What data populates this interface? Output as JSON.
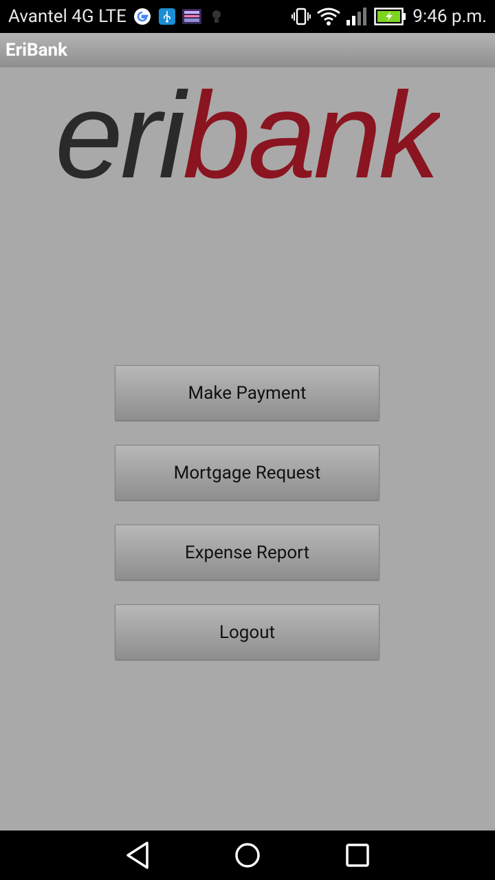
{
  "status_bar": {
    "carrier": "Avantel 4G LTE",
    "time": "9:46 p.m.",
    "icons": [
      "google-icon",
      "usb-icon",
      "app-notification-icon",
      "bulb-icon",
      "vibrate-icon",
      "wifi-icon",
      "signal-icon",
      "battery-charging-icon"
    ],
    "battery_color": "#7ed321"
  },
  "action_bar": {
    "title": "EriBank"
  },
  "logo": {
    "part1": "eri",
    "part2": "bank",
    "color_part1": "#2a2a2a",
    "color_part2": "#8a1420"
  },
  "buttons": {
    "make_payment": "Make Payment",
    "mortgage_request": "Mortgage Request",
    "expense_report": "Expense Report",
    "logout": "Logout"
  },
  "nav_bar": {
    "icons": [
      "back-icon",
      "home-icon",
      "recents-icon"
    ]
  }
}
